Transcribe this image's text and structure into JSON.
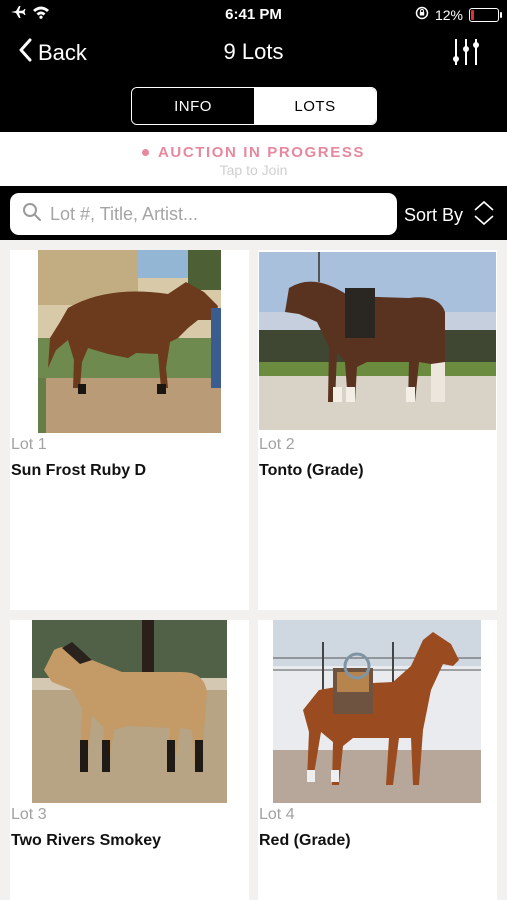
{
  "status_bar": {
    "time": "6:41 PM",
    "battery_percent": "12%",
    "battery_level": 0.12,
    "icons": [
      "airplane-icon",
      "wifi-icon",
      "orientation-lock-icon",
      "battery-icon"
    ]
  },
  "nav": {
    "back_label": "Back",
    "title": "9 Lots",
    "tabs": [
      {
        "label": "INFO",
        "active": false
      },
      {
        "label": "LOTS",
        "active": true
      }
    ]
  },
  "banner": {
    "status": "AUCTION IN PROGRESS",
    "subtitle": "Tap to Join",
    "accent_color": "#e7889e"
  },
  "search": {
    "placeholder": "Lot #, Title, Artist...",
    "value": "",
    "sort_label": "Sort By"
  },
  "lots": [
    {
      "lot": "Lot 1",
      "title": "Sun Frost Ruby D"
    },
    {
      "lot": "Lot 2",
      "title": "Tonto (Grade)"
    },
    {
      "lot": "Lot 3",
      "title": "Two Rivers Smokey"
    },
    {
      "lot": "Lot 4",
      "title": "Red (Grade)"
    }
  ]
}
